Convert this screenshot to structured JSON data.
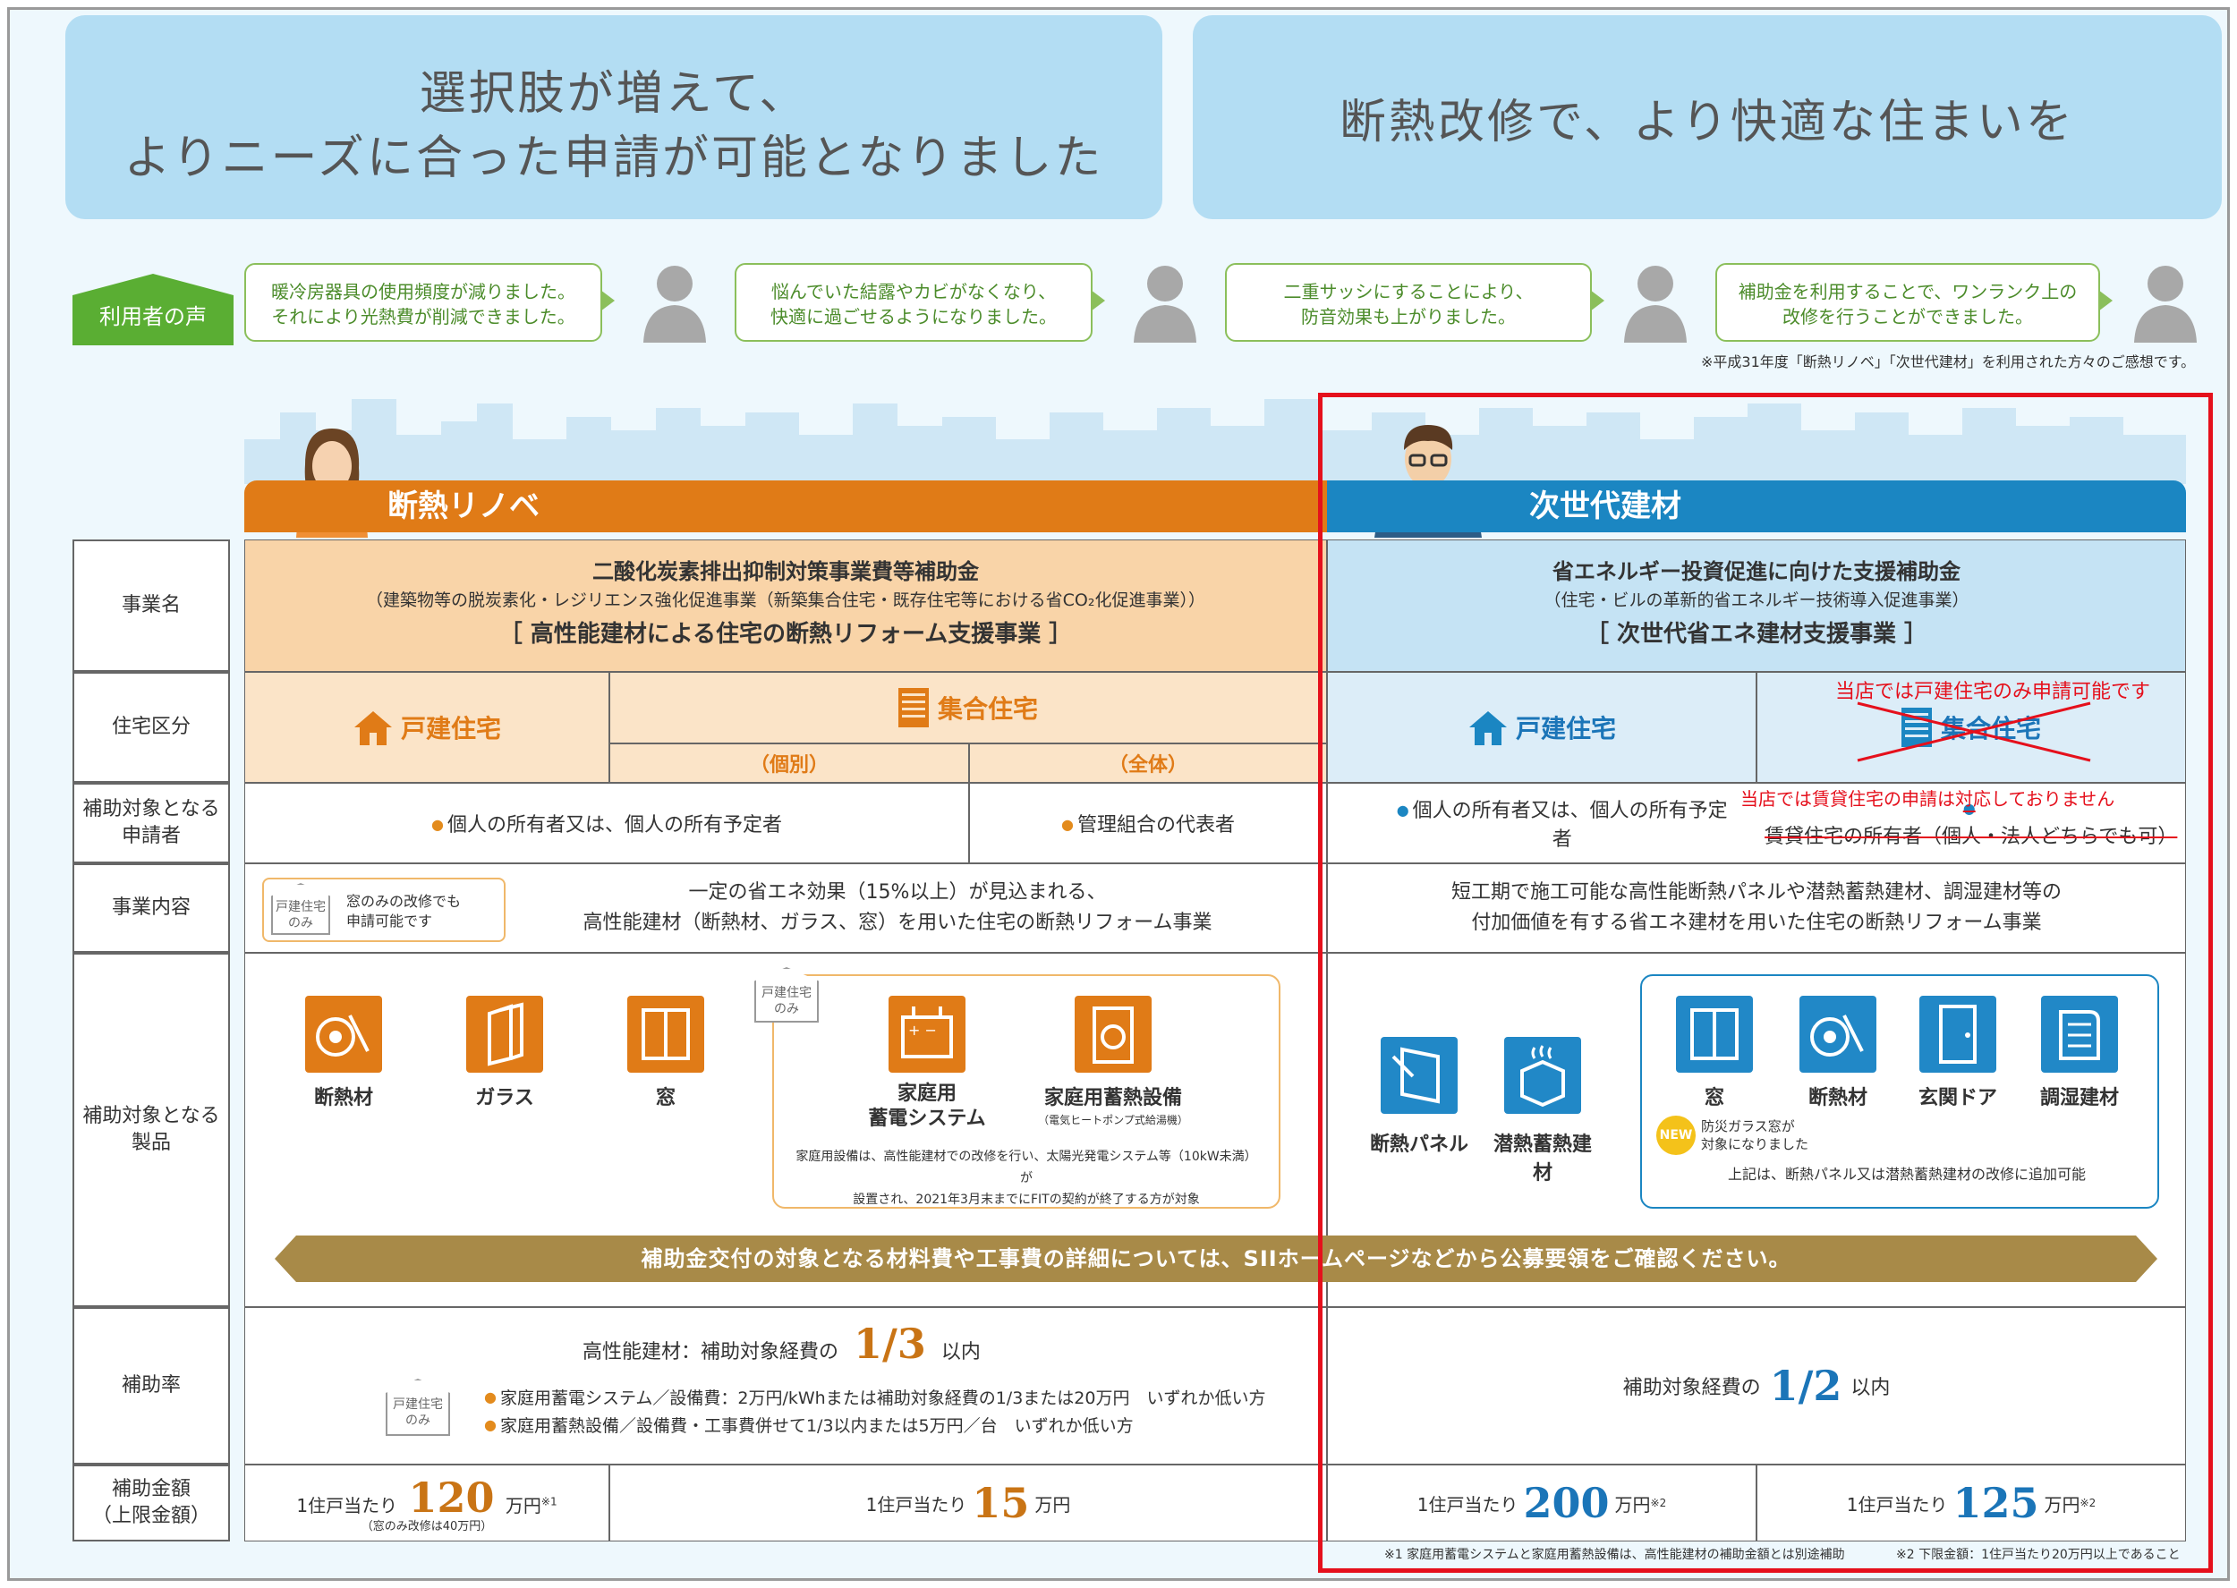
{
  "banners": {
    "left_line1": "選択肢が増えて、",
    "left_line2": "よりニーズに合った申請が可能となりました",
    "right": "断熱改修で、より快適な住まいを"
  },
  "voices": {
    "tag": "利用者の声",
    "items": [
      {
        "line1": "暖冷房器具の使用頻度が減りました。",
        "line2": "それにより光熱費が削減できました。"
      },
      {
        "line1": "悩んでいた結露やカビがなくなり、",
        "line2": "快適に過ごせるようになりました。"
      },
      {
        "line1": "二重サッシにすることにより、",
        "line2": "防音効果も上がりました。"
      },
      {
        "line1": "補助金を利用することで、ワンランク上の",
        "line2": "改修を行うことができました。"
      }
    ],
    "note": "※平成31年度「断熱リノベ」「次世代建材」を利用された方々のご感想です。"
  },
  "tabs": {
    "left": "断熱リノベ",
    "right": "次世代建材"
  },
  "row_labels": {
    "jigyomei": "事業名",
    "jutaku": "住宅区分",
    "shinseisha_1": "補助対象となる",
    "shinseisha_2": "申請者",
    "naiyo": "事業内容",
    "seihin_1": "補助対象となる",
    "seihin_2": "製品",
    "ritsu": "補助率",
    "kingaku_1": "補助金額",
    "kingaku_2": "（上限金額）"
  },
  "left": {
    "title": "二酸化炭素排出抑制対策事業費等補助金",
    "subtitle": "（建築物等の脱炭素化・レジリエンス強化促進事業（新築集合住宅・既存住宅等における省CO₂化促進事業））",
    "program": "［ 高性能建材による住宅の断熱リフォーム支援事業 ］",
    "house_detached": "戸建住宅",
    "house_collective": "集合住宅",
    "individual": "（個別）",
    "whole": "（全体）",
    "applicant_individual": "個人の所有者又は、個人の所有予定者",
    "applicant_whole": "管理組合の代表者",
    "detached_only_1": "戸建住宅",
    "detached_only_2": "のみ",
    "window_only_1": "窓のみの改修でも",
    "window_only_2": "申請可能です",
    "content_1": "一定の省エネ効果（15%以上）が見込まれる、",
    "content_2": "高性能建材（断熱材、ガラス、窓）を用いた住宅の断熱リフォーム事業",
    "products": [
      "断熱材",
      "ガラス",
      "窓"
    ],
    "prod_battery_1": "家庭用",
    "prod_battery_2": "蓄電システム",
    "prod_heat": "家庭用蓄熱設備",
    "prod_heat_note": "（電気ヒートポンプ式給湯機）",
    "equip_note_1": "家庭用設備は、高性能建材での改修を行い、太陽光発電システム等（10kW未満）が",
    "equip_note_2": "設置され、2021年3月末までにFITの契約が終了する方が対象",
    "rate_lead": "高性能建材：補助対象経費の",
    "rate_value": "1/3",
    "rate_suffix": "以内",
    "rate_item1": "家庭用蓄電システム／設備費：2万円/kWhまたは補助対象経費の1/3または20万円　いずれか低い方",
    "rate_item2": "家庭用蓄熱設備／設備費・工事費併せて1/3以内または5万円／台　いずれか低い方",
    "amount1_lead": "1住戸当たり",
    "amount1_value": "120",
    "amount1_unit": "万円",
    "amount1_mark": "※1",
    "amount1_note": "（窓のみ改修は40万円）",
    "amount2_lead": "1住戸当たり",
    "amount2_value": "15",
    "amount2_unit": "万円"
  },
  "banner_arrow": "補助金交付の対象となる材料費や工事費の詳細については、SIIホームページなどから公募要領をご確認ください。",
  "right": {
    "title": "省エネルギー投資促進に向けた支援補助金",
    "subtitle": "（住宅・ビルの革新的省エネルギー技術導入促進事業）",
    "program": "［ 次世代省エネ建材支援事業 ］",
    "house_detached": "戸建住宅",
    "house_collective": "集合住宅",
    "red_note_1": "当店では戸建住宅のみ申請可能です",
    "red_note_2": "当店では賃貸住宅の申請は対応しておりません",
    "applicant_individual": "個人の所有者又は、個人の所有予定者",
    "applicant_rental": "賃貸住宅の所有者（個人・法人どちらでも可）",
    "content_1": "短工期で施工可能な高性能断熱パネルや潜熱蓄熱建材、調湿建材等の",
    "content_2": "付加価値を有する省エネ建材を用いた住宅の断熱リフォーム事業",
    "products_main": [
      "断熱パネル",
      "潜熱蓄熱建材"
    ],
    "products_extra": [
      "窓",
      "断熱材",
      "玄関ドア",
      "調湿建材"
    ],
    "new_badge": "NEW",
    "new_note_1": "防災ガラス窓が",
    "new_note_2": "対象になりました",
    "extra_note": "上記は、断熱パネル又は潜熱蓄熱建材の改修に追加可能",
    "rate_lead": "補助対象経費の",
    "rate_value": "1/2",
    "rate_suffix": "以内",
    "amount1_lead": "1住戸当たり",
    "amount1_value": "200",
    "amount1_unit": "万円",
    "amount1_mark": "※2",
    "amount2_lead": "1住戸当たり",
    "amount2_value": "125",
    "amount2_unit": "万円",
    "amount2_mark": "※2"
  },
  "footnotes": {
    "n1": "※1 家庭用蓄電システムと家庭用蓄熱設備は、高性能建材の補助金額とは別途補助",
    "n2": "※2 下限金額：1住戸当たり20万円以上であること"
  },
  "colors": {
    "orange": "#e07b17",
    "blue": "#2188c7",
    "green": "#5aae33",
    "red": "#e5101c",
    "olive": "#a88a48"
  }
}
